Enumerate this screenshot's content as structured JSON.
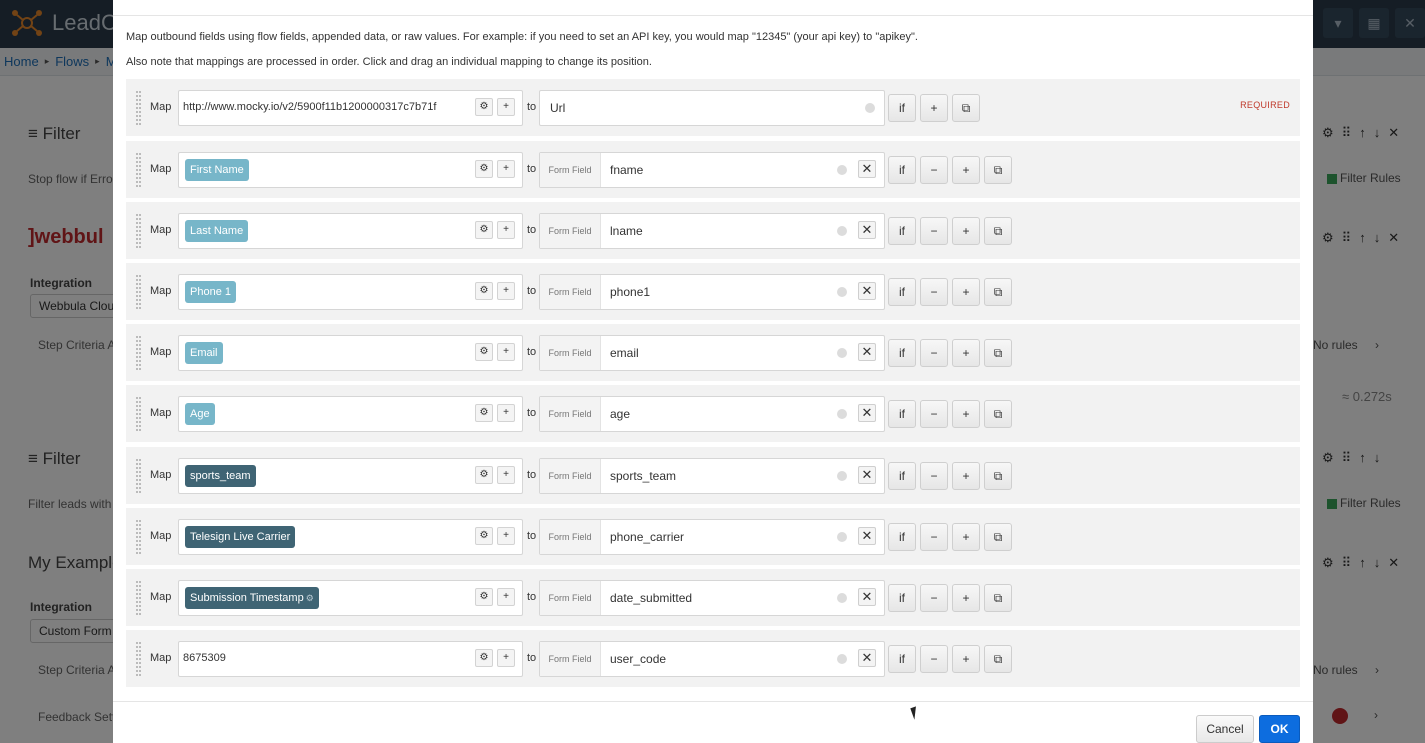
{
  "app": {
    "logo_text": "LeadC",
    "breadcrumb": [
      "Home",
      "Flows",
      "M"
    ],
    "top_buttons": [
      "▾",
      "▦",
      "✕"
    ],
    "bg": {
      "filter_heading_1": "Filter",
      "filter_text_1": "Stop flow if Error",
      "filter_rules_1": "Filter Rules",
      "webbula_logo": "]webbul",
      "integration_label_1": "Integration",
      "integration_select_1": "Webbula Cloud",
      "step_criteria_1": "Step Criteria A",
      "no_rules_1": "No rules",
      "timing": "≈ 0.272s",
      "filter_heading_2": "Filter",
      "filter_text_2": "Filter leads with",
      "filter_rules_2": "Filter Rules",
      "example_heading": "My Example",
      "integration_label_2": "Integration",
      "integration_select_2": "Custom Form",
      "step_criteria_2": "Step Criteria A",
      "no_rules_2": "No rules",
      "feedback": "Feedback Sett"
    }
  },
  "modal": {
    "intro_1": "Map outbound fields using flow fields, appended data, or raw values. For example: if you need to set an API key, you would map \"12345\" (your api key) to \"apikey\".",
    "intro_2": "Also note that mappings are processed in order. Click and drag an individual mapping to change its position.",
    "map_label": "Map",
    "to_label": "to",
    "form_field_label": "Form Field",
    "required_label": "REQUIRED",
    "if_label": "if",
    "minus_label": "−",
    "plus_label": "+",
    "rows": [
      {
        "source_type": "text",
        "source": "http://www.mocky.io/v2/5900f11b1200000317c7b71f",
        "destination": "Url",
        "required": true
      },
      {
        "source_type": "light",
        "source": "First Name",
        "destination": "fname"
      },
      {
        "source_type": "light",
        "source": "Last Name",
        "destination": "lname"
      },
      {
        "source_type": "light",
        "source": "Phone 1",
        "destination": "phone1"
      },
      {
        "source_type": "light",
        "source": "Email",
        "destination": "email"
      },
      {
        "source_type": "light",
        "source": "Age",
        "destination": "age"
      },
      {
        "source_type": "dark",
        "source": "sports_team",
        "destination": "sports_team"
      },
      {
        "source_type": "dark",
        "source": "Telesign Live Carrier",
        "destination": "phone_carrier"
      },
      {
        "source_type": "dark-gear",
        "source": "Submission Timestamp",
        "destination": "date_submitted"
      },
      {
        "source_type": "text",
        "source": "8675309",
        "destination": "user_code"
      }
    ],
    "cancel_label": "Cancel",
    "ok_label": "OK"
  }
}
